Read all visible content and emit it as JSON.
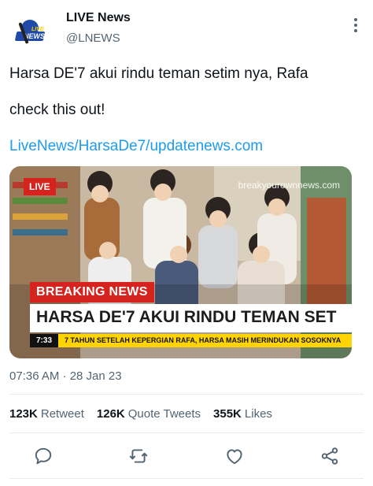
{
  "account": {
    "name": "LIVE News",
    "handle": "@LNEWS",
    "logo_text_top": "LIVE",
    "logo_text_bottom": "NEWS"
  },
  "tweet": {
    "line1": "Harsa DE'7 akui rindu teman setim nya, Rafa",
    "line2": "check this out!",
    "link": "LiveNews/HarsaDe7/updatenews.com"
  },
  "media": {
    "live_badge": "LIVE",
    "watermark": "breakyourownnews.com",
    "breaking_label": "BREAKING NEWS",
    "headline": "HARSA DE'7 AKUI RINDU TEMAN SET",
    "ticker_time": "7:33",
    "ticker_text": "7 TAHUN SETELAH KEPERGIAN RAFA, HARSA MASIH MERINDUKAN SOSOKNYA"
  },
  "meta": {
    "timestamp": "07:36 AM · 28 Jan 23"
  },
  "stats": {
    "retweets_count": "123K",
    "retweets_label": "Retweet",
    "quotes_count": "126K",
    "quotes_label": "Quote Tweets",
    "likes_count": "355K",
    "likes_label": "Likes"
  },
  "icons": {
    "reply": "reply-icon",
    "retweet": "retweet-icon",
    "like": "like-icon",
    "share": "share-icon",
    "more": "more-icon"
  },
  "colors": {
    "link": "#1d9bf0",
    "breaking_red": "#d6231e",
    "ticker_yellow": "#ffd400",
    "muted": "#536471"
  }
}
